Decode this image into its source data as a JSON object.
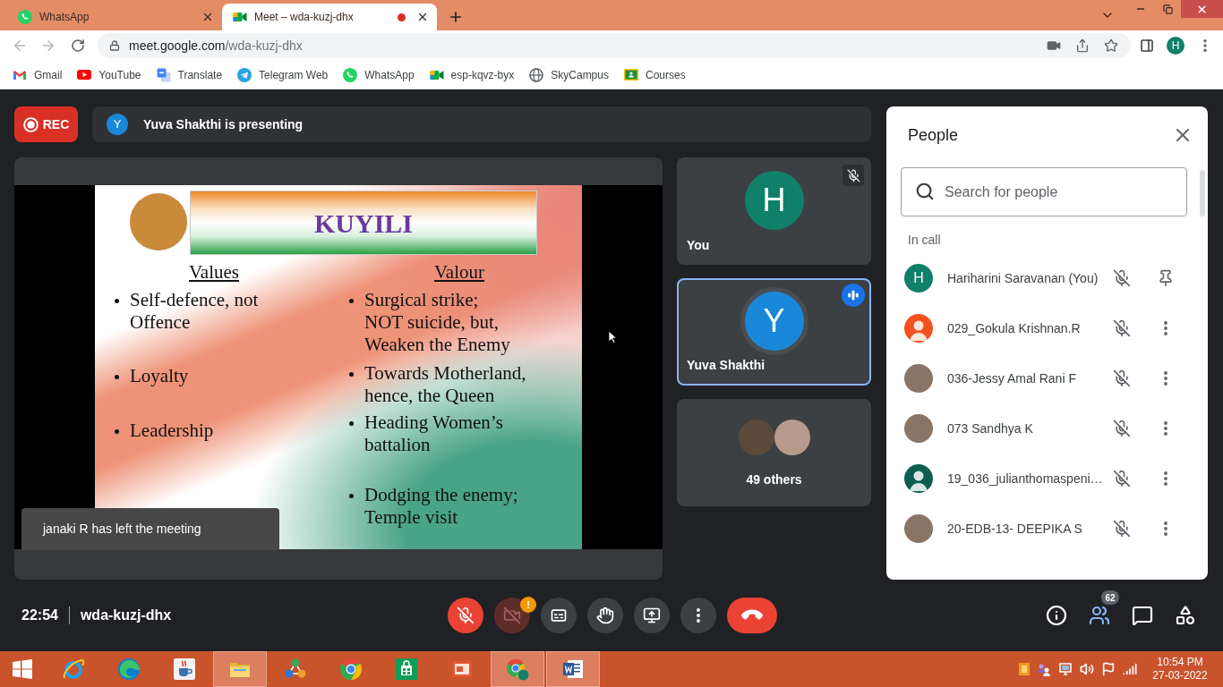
{
  "browser": {
    "tabs": [
      {
        "title": "WhatsApp",
        "kind": "whatsapp",
        "selected": false,
        "recording": false
      },
      {
        "title": "Meet – wda-kuzj-dhx",
        "kind": "meet",
        "selected": true,
        "recording": true
      }
    ],
    "url": {
      "host": "meet.google.com",
      "path": "/wda-kuzj-dhx"
    },
    "profile_initial": "H",
    "bookmarks": [
      {
        "label": "Gmail",
        "kind": "gmail"
      },
      {
        "label": "YouTube",
        "kind": "youtube"
      },
      {
        "label": "Translate",
        "kind": "translate"
      },
      {
        "label": "Telegram Web",
        "kind": "telegram"
      },
      {
        "label": "WhatsApp",
        "kind": "whatsapp"
      },
      {
        "label": "esp-kqvz-byx",
        "kind": "meet"
      },
      {
        "label": "SkyCampus",
        "kind": "globe"
      },
      {
        "label": "Courses",
        "kind": "classroom"
      }
    ]
  },
  "meeting": {
    "recording_label": "REC",
    "presenter": {
      "initial": "Y",
      "text": "Yuva Shakthi is presenting"
    },
    "slide": {
      "title": "KUYILI",
      "columns": [
        {
          "heading": "Values",
          "items": [
            {
              "lines": [
                "Self-defence, not",
                "Offence"
              ]
            },
            {
              "lines": [
                "Loyalty"
              ]
            },
            {
              "lines": [
                "Leadership"
              ]
            }
          ]
        },
        {
          "heading": "Valour",
          "items": [
            {
              "lines": [
                "Surgical strike;",
                "NOT suicide, but,",
                "Weaken the Enemy"
              ]
            },
            {
              "lines": [
                "Towards Motherland,",
                "hence, the Queen"
              ]
            },
            {
              "lines": [
                "Heading Women’s",
                "battalion"
              ]
            },
            {
              "lines": [
                "Dodging the enemy;",
                "Temple visit"
              ]
            }
          ]
        }
      ]
    },
    "notification": "janaki R has left the meeting",
    "tiles": [
      {
        "kind": "avatar",
        "initial": "H",
        "color": "#11806a",
        "label": "You",
        "muted": true,
        "speaking": false
      },
      {
        "kind": "avatar",
        "initial": "Y",
        "color": "#1a88d8",
        "label": "Yuva Shakthi",
        "muted": false,
        "speaking": true
      },
      {
        "kind": "group",
        "label": "49 others"
      }
    ]
  },
  "people": {
    "title": "People",
    "search_placeholder": "Search for people",
    "section": "In call",
    "participants": [
      {
        "name": "Hariharini Saravanan (You)",
        "avatar": {
          "kind": "initial",
          "initial": "H",
          "color": "#11806a"
        },
        "muted": true,
        "action": {
          "kind": "pin"
        }
      },
      {
        "name": "029_Gokula Krishnan.R",
        "avatar": {
          "kind": "silhouette",
          "color": "#f4511e"
        },
        "muted": true,
        "action": {
          "kind": "more"
        }
      },
      {
        "name": "036-Jessy Amal Rani F",
        "avatar": {
          "kind": "photo"
        },
        "muted": true,
        "action": {
          "kind": "more"
        }
      },
      {
        "name": "073 Sandhya K",
        "avatar": {
          "kind": "photo"
        },
        "muted": true,
        "action": {
          "kind": "more"
        }
      },
      {
        "name": "19_036_julianthomaspeni…",
        "avatar": {
          "kind": "silhouette",
          "color": "#0b5e50"
        },
        "muted": true,
        "action": {
          "kind": "more"
        }
      },
      {
        "name": "20-EDB-13- DEEPIKA S",
        "avatar": {
          "kind": "photo"
        },
        "muted": true,
        "action": {
          "kind": "more"
        }
      }
    ]
  },
  "controls": {
    "time": "22:54",
    "meeting_code": "wda-kuzj-dhx",
    "center": [
      {
        "kind": "mic",
        "on": false,
        "disabled": false
      },
      {
        "kind": "camera",
        "on": false,
        "disabled": true,
        "badge": "!"
      },
      {
        "kind": "captions"
      },
      {
        "kind": "hand"
      },
      {
        "kind": "present"
      },
      {
        "kind": "more"
      },
      {
        "kind": "leave"
      }
    ],
    "side": [
      {
        "kind": "info",
        "selected": false
      },
      {
        "kind": "people",
        "selected": true,
        "badge": "62"
      },
      {
        "kind": "chat",
        "selected": false
      },
      {
        "kind": "activities",
        "selected": false
      }
    ]
  },
  "taskbar": {
    "apps": [
      {
        "kind": "ie",
        "open": false
      },
      {
        "kind": "edge",
        "open": false
      },
      {
        "kind": "java",
        "open": false
      },
      {
        "kind": "explorer",
        "open": true
      },
      {
        "kind": "network",
        "open": false
      },
      {
        "kind": "chrome",
        "open": false
      },
      {
        "kind": "store",
        "open": false
      },
      {
        "kind": "slides",
        "open": false
      },
      {
        "kind": "chrome-profile",
        "open": true
      },
      {
        "kind": "word",
        "open": true
      }
    ],
    "tray": [
      {
        "kind": "app"
      },
      {
        "kind": "sharing"
      },
      {
        "kind": "display"
      },
      {
        "kind": "speaker"
      },
      {
        "kind": "flag"
      },
      {
        "kind": "signal"
      }
    ],
    "time": "10:54 PM",
    "date": "27-03-2022"
  }
}
